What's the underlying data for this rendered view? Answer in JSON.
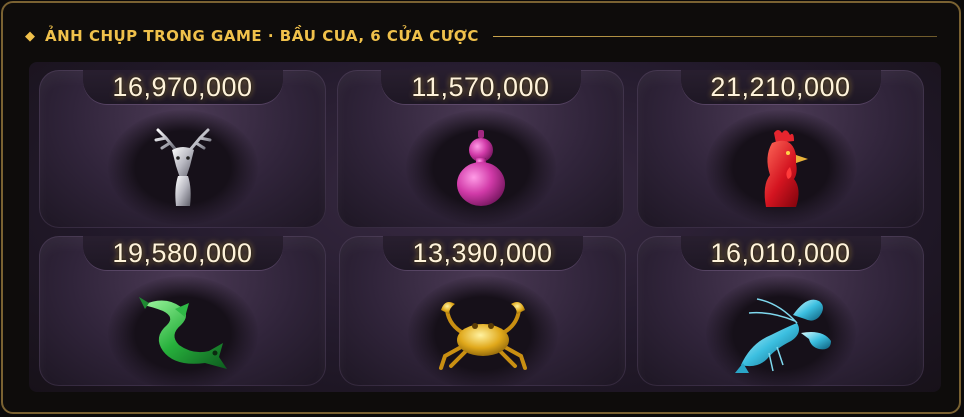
{
  "header": {
    "title": "ẢNH CHỤP TRONG GAME · BẦU CUA, 6 CỬA CƯỢC",
    "accent_color": "#f0c14b",
    "icon": "diamond-icon"
  },
  "cells": [
    {
      "symbol": "deer",
      "icon": "deer-icon",
      "amount": "16,970,000"
    },
    {
      "symbol": "gourd",
      "icon": "gourd-icon",
      "amount": "11,570,000"
    },
    {
      "symbol": "rooster",
      "icon": "rooster-icon",
      "amount": "21,210,000"
    },
    {
      "symbol": "fish",
      "icon": "fish-icon",
      "amount": "19,580,000"
    },
    {
      "symbol": "crab",
      "icon": "crab-icon",
      "amount": "13,390,000"
    },
    {
      "symbol": "shrimp",
      "icon": "shrimp-icon",
      "amount": "16,010,000"
    }
  ]
}
